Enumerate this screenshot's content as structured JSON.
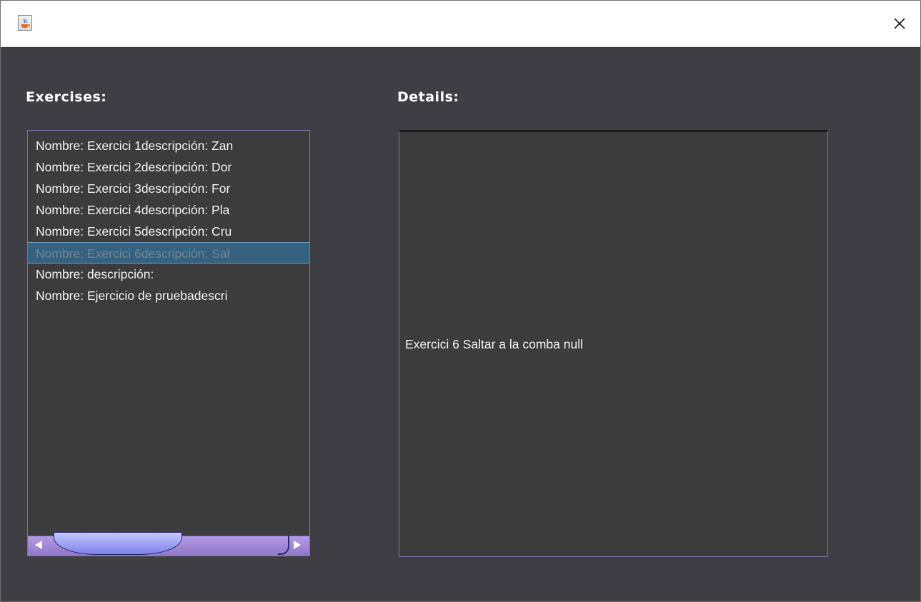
{
  "window": {
    "icon": "java-cup-icon",
    "close_glyph": "✕"
  },
  "exercises": {
    "heading": "Exercises:",
    "items": [
      {
        "label": "Nombre: Exercici 1descripción: Zan",
        "selected": false
      },
      {
        "label": "Nombre: Exercici 2descripción: Dor",
        "selected": false
      },
      {
        "label": "Nombre: Exercici 3descripción: For",
        "selected": false
      },
      {
        "label": "Nombre: Exercici 4descripción: Pla",
        "selected": false
      },
      {
        "label": "Nombre: Exercici 5descripción: Cru",
        "selected": false
      },
      {
        "label": "Nombre: Exercici 6descripción: Sal",
        "selected": true
      },
      {
        "label": "Nombre: descripción:",
        "selected": false
      },
      {
        "label": "Nombre: Ejercicio de pruebadescri",
        "selected": false
      }
    ]
  },
  "details": {
    "heading": "Details:",
    "text": "Exercici 6 Saltar a la comba null"
  }
}
